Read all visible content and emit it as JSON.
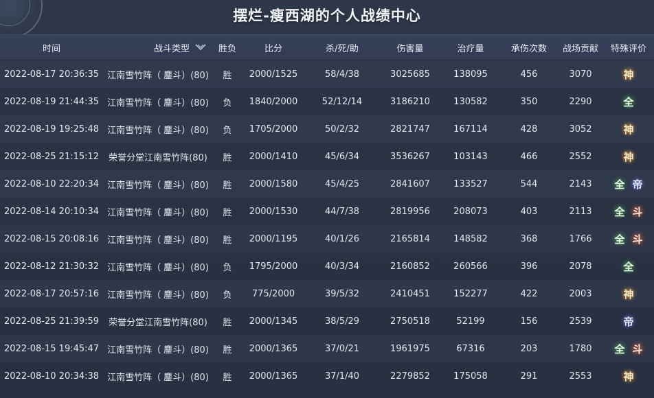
{
  "title": "摆烂-瘦西湖的个人战绩中心",
  "headers": {
    "time": "时间",
    "type": "战斗类型",
    "result": "胜负",
    "score": "比分",
    "kda": "杀/死/助",
    "damage": "伤害量",
    "heal": "治疗量",
    "hits_taken": "承伤次数",
    "contribution": "战场贡献",
    "special": "特殊评价"
  },
  "rows": [
    {
      "time": "2022-08-17 20:36:35",
      "type": "江南雪竹阵（ 鏖斗）(80)",
      "result": "胜",
      "score": "2000/1525",
      "kda": "58/4/38",
      "damage": "3025685",
      "heal": "138095",
      "hits_taken": "456",
      "contribution": "3070",
      "badges": [
        "神"
      ]
    },
    {
      "time": "2022-08-19 21:44:35",
      "type": "江南雪竹阵（ 鏖斗）(80)",
      "result": "负",
      "score": "1840/2000",
      "kda": "52/12/14",
      "damage": "3186210",
      "heal": "130582",
      "hits_taken": "350",
      "contribution": "2290",
      "badges": [
        "全"
      ]
    },
    {
      "time": "2022-08-19 19:25:48",
      "type": "江南雪竹阵（ 鏖斗）(80)",
      "result": "负",
      "score": "1705/2000",
      "kda": "50/2/32",
      "damage": "2821747",
      "heal": "167114",
      "hits_taken": "428",
      "contribution": "3052",
      "badges": [
        "神"
      ]
    },
    {
      "time": "2022-08-25 21:15:12",
      "type": "荣誉分堂江南雪竹阵(80)",
      "result": "胜",
      "score": "2000/1410",
      "kda": "45/6/34",
      "damage": "3536267",
      "heal": "103143",
      "hits_taken": "466",
      "contribution": "2552",
      "badges": [
        "神"
      ]
    },
    {
      "time": "2022-08-10 22:20:34",
      "type": "江南雪竹阵（ 鏖斗）(80)",
      "result": "胜",
      "score": "2000/1580",
      "kda": "45/4/25",
      "damage": "2841607",
      "heal": "133527",
      "hits_taken": "544",
      "contribution": "2143",
      "badges": [
        "全",
        "帝"
      ]
    },
    {
      "time": "2022-08-14 20:10:34",
      "type": "江南雪竹阵（ 鏖斗）(80)",
      "result": "胜",
      "score": "2000/1530",
      "kda": "44/7/38",
      "damage": "2819956",
      "heal": "208073",
      "hits_taken": "403",
      "contribution": "2113",
      "badges": [
        "全",
        "斗"
      ]
    },
    {
      "time": "2022-08-15 20:08:16",
      "type": "江南雪竹阵（ 鏖斗）(80)",
      "result": "胜",
      "score": "2000/1195",
      "kda": "40/1/26",
      "damage": "2165814",
      "heal": "148582",
      "hits_taken": "368",
      "contribution": "1766",
      "badges": [
        "全",
        "斗"
      ]
    },
    {
      "time": "2022-08-12 21:30:32",
      "type": "江南雪竹阵（ 鏖斗）(80)",
      "result": "负",
      "score": "1795/2000",
      "kda": "40/3/34",
      "damage": "2160852",
      "heal": "260566",
      "hits_taken": "396",
      "contribution": "2078",
      "badges": [
        "全"
      ]
    },
    {
      "time": "2022-08-17 20:57:16",
      "type": "江南雪竹阵（ 鏖斗）(80)",
      "result": "负",
      "score": "775/2000",
      "kda": "39/5/32",
      "damage": "2410451",
      "heal": "152277",
      "hits_taken": "422",
      "contribution": "2003",
      "badges": [
        "神"
      ]
    },
    {
      "time": "2022-08-25 21:39:59",
      "type": "荣誉分堂江南雪竹阵(80)",
      "result": "胜",
      "score": "2000/1345",
      "kda": "38/5/29",
      "damage": "2750518",
      "heal": "52199",
      "hits_taken": "156",
      "contribution": "2539",
      "badges": [
        "帝"
      ]
    },
    {
      "time": "2022-08-15 19:45:47",
      "type": "江南雪竹阵（ 鏖斗）(80)",
      "result": "胜",
      "score": "2000/1365",
      "kda": "37/0/21",
      "damage": "1961975",
      "heal": "67316",
      "hits_taken": "203",
      "contribution": "1780",
      "badges": [
        "全",
        "斗"
      ]
    },
    {
      "time": "2022-08-10 20:34:38",
      "type": "江南雪竹阵（ 鏖斗）(80)",
      "result": "胜",
      "score": "2000/1365",
      "kda": "37/1/40",
      "damage": "2279852",
      "heal": "175058",
      "hits_taken": "291",
      "contribution": "2553",
      "badges": [
        "神"
      ]
    }
  ],
  "badge_colors": {
    "神": "#c9964a",
    "全": "#4f9c5c",
    "帝": "#6a74c4",
    "斗": "#c46a50"
  }
}
